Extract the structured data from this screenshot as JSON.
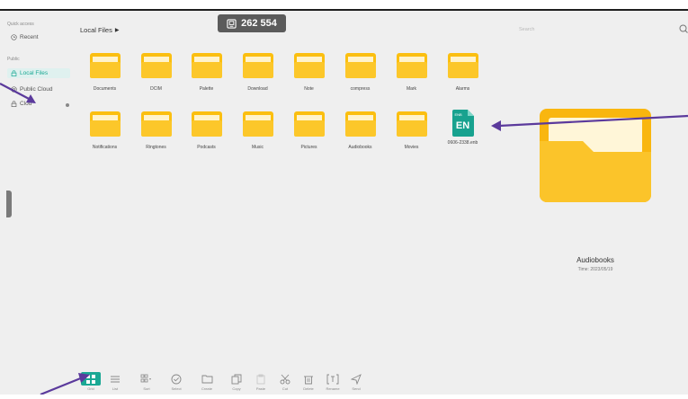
{
  "sidebar": {
    "quick_access": "Quick access",
    "recent": "Recent",
    "public_heading": "Public",
    "local_files": "Local Files",
    "public_cloud": "Public Cloud",
    "cloud_item": "Clou"
  },
  "header": {
    "title": "Local Files",
    "counter": "262 554",
    "search_placeholder": "Search"
  },
  "items": [
    {
      "label": "Documents"
    },
    {
      "label": "DCIM"
    },
    {
      "label": "Palette"
    },
    {
      "label": "Download"
    },
    {
      "label": "Note"
    },
    {
      "label": "compress"
    },
    {
      "label": "Mark"
    },
    {
      "label": "Alarms"
    },
    {
      "label": "Notifications"
    },
    {
      "label": "Ringtones"
    },
    {
      "label": "Podcasts"
    },
    {
      "label": "Music"
    },
    {
      "label": "Pictures"
    },
    {
      "label": "Audiobooks"
    },
    {
      "label": "Movies"
    },
    {
      "label": "0606-2338.enb",
      "file_badge": "EN",
      "file_tag": "ENB"
    }
  ],
  "preview": {
    "name": "Audiobooks",
    "time": "Time: 2023/05/19"
  },
  "toolbar": [
    {
      "label": "Grid",
      "icon": "grid-icon",
      "active": true
    },
    {
      "label": "List",
      "icon": "list-icon"
    },
    {
      "label": "Sort",
      "icon": "sort-icon"
    },
    {
      "label": "Select",
      "icon": "select-icon"
    },
    {
      "label": "Create",
      "icon": "create-folder-icon"
    },
    {
      "label": "Copy",
      "icon": "copy-icon"
    },
    {
      "label": "Paste",
      "icon": "paste-icon"
    },
    {
      "label": "Cut",
      "icon": "cut-icon"
    },
    {
      "label": "Delete",
      "icon": "delete-icon"
    },
    {
      "label": "Rename",
      "icon": "rename-icon"
    },
    {
      "label": "Send",
      "icon": "send-icon"
    }
  ],
  "colors": {
    "accent": "#1aa894",
    "folder": "#fbbf10",
    "annotation_arrow": "#5b3a9c"
  }
}
